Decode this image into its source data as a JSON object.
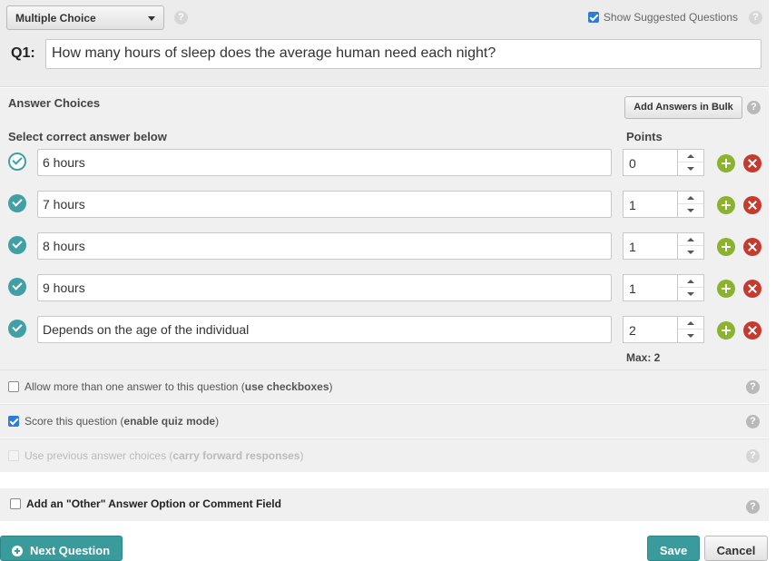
{
  "header": {
    "question_type": "Multiple Choice",
    "show_suggested_label": "Show Suggested Questions",
    "show_suggested_checked": true,
    "question_number": "Q1:",
    "question_text": "How many hours of sleep does the average human need each night?"
  },
  "answers": {
    "section_title": "Answer Choices",
    "bulk_button": "Add Answers in Bulk",
    "select_label": "Select correct answer below",
    "points_label": "Points",
    "items": [
      {
        "text": "6 hours",
        "points": "0",
        "selected": false
      },
      {
        "text": "7 hours",
        "points": "1",
        "selected": true
      },
      {
        "text": "8 hours",
        "points": "1",
        "selected": true
      },
      {
        "text": "9 hours",
        "points": "1",
        "selected": true
      },
      {
        "text": "Depends on the age of the individual",
        "points": "2",
        "selected": true
      }
    ],
    "max_label": "Max: 2"
  },
  "options": [
    {
      "prefix": "Allow more than one answer to this question (",
      "bold": "use checkboxes",
      "suffix": ")",
      "checked": false,
      "disabled": false
    },
    {
      "prefix": "Score this question (",
      "bold": "enable quiz mode",
      "suffix": ")",
      "checked": true,
      "disabled": false
    },
    {
      "prefix": "Use previous answer choices (",
      "bold": "carry forward responses",
      "suffix": ")",
      "checked": false,
      "disabled": true
    }
  ],
  "other": {
    "label": "Add an \"Other\" Answer Option or Comment Field",
    "checked": false
  },
  "footer": {
    "next_button": "Next Question",
    "save_button": "Save",
    "cancel_button": "Cancel"
  },
  "help_icon_glyph": "?",
  "colors": {
    "accent": "#3a9b9d",
    "add": "#8ab32f",
    "delete": "#c63a2f",
    "checkbox": "#2f7bd9"
  }
}
